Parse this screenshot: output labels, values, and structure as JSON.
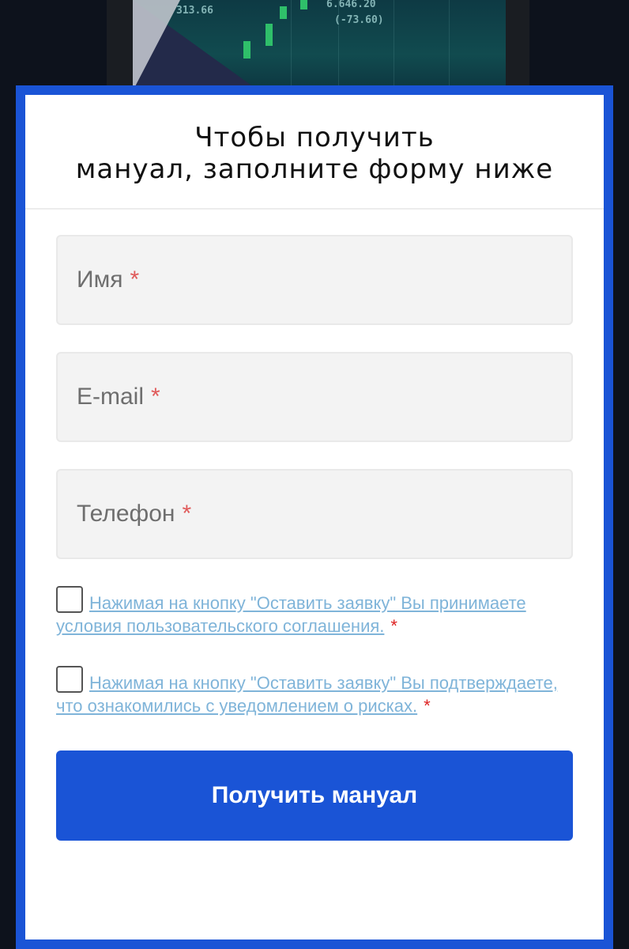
{
  "background": {
    "ticker_values": [
      "313.66",
      "6.646.20",
      "(-73.60)"
    ]
  },
  "modal": {
    "title": "Чтобы получить\nмануал, заполните форму ниже",
    "fields": [
      {
        "placeholder": "Имя",
        "required_mark": "*"
      },
      {
        "placeholder": "E-mail",
        "required_mark": "*"
      },
      {
        "placeholder": "Телефон",
        "required_mark": "*"
      }
    ],
    "consents": [
      {
        "text": "Нажимая на кнопку \"Оставить заявку\" Вы принимаете условия пользовательского соглашения.",
        "required_mark": "*",
        "checked": false
      },
      {
        "text": "Нажимая на кнопку \"Оставить заявку\" Вы подтверждаете, что ознакомились с уведомлением о рисках.",
        "required_mark": "*",
        "checked": false
      }
    ],
    "submit_label": "Получить мануал"
  },
  "colors": {
    "accent": "#1a54d6",
    "link": "#7fb4d9",
    "required": "#d22222"
  }
}
